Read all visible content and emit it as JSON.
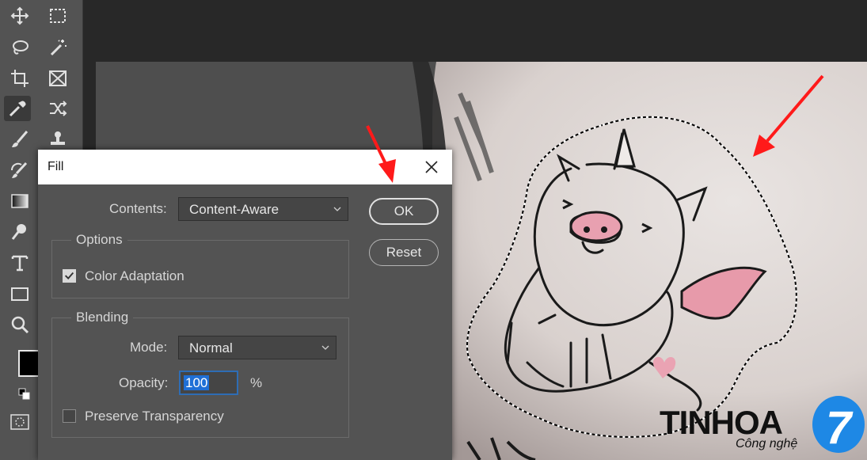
{
  "dialog": {
    "title": "Fill",
    "contents_label": "Contents:",
    "contents_value": "Content-Aware",
    "options_title": "Options",
    "color_adaptation_label": "Color Adaptation",
    "blending_title": "Blending",
    "mode_label": "Mode:",
    "mode_value": "Normal",
    "opacity_label": "Opacity:",
    "opacity_value": "100",
    "opacity_unit": "%",
    "preserve_label": "Preserve Transparency",
    "ok_label": "OK",
    "reset_label": "Reset"
  },
  "logo": {
    "brand": "TINHOA",
    "tagline": "Công nghệ",
    "badge": "7"
  },
  "colors": {
    "toolbar_bg": "#535353",
    "dialog_bg": "#535353",
    "accent_blue": "#1f6fd6",
    "arrow_red": "#ff1a1a",
    "logo_blue": "#1e88e5"
  },
  "icons": [
    "move-icon",
    "marquee-icon",
    "lasso-icon",
    "magic-wand-icon",
    "crop-icon",
    "frame-icon",
    "eyedropper-icon",
    "content-aware-move-icon",
    "brush-icon",
    "stamp-icon",
    "history-brush-icon",
    "gradient-icon",
    "dodge-icon",
    "type-icon",
    "rectangle-icon",
    "zoom-icon",
    "swap-colors-icon",
    "quick-mask-icon",
    "close-icon",
    "chevron-down-icon",
    "checkmark-icon"
  ]
}
